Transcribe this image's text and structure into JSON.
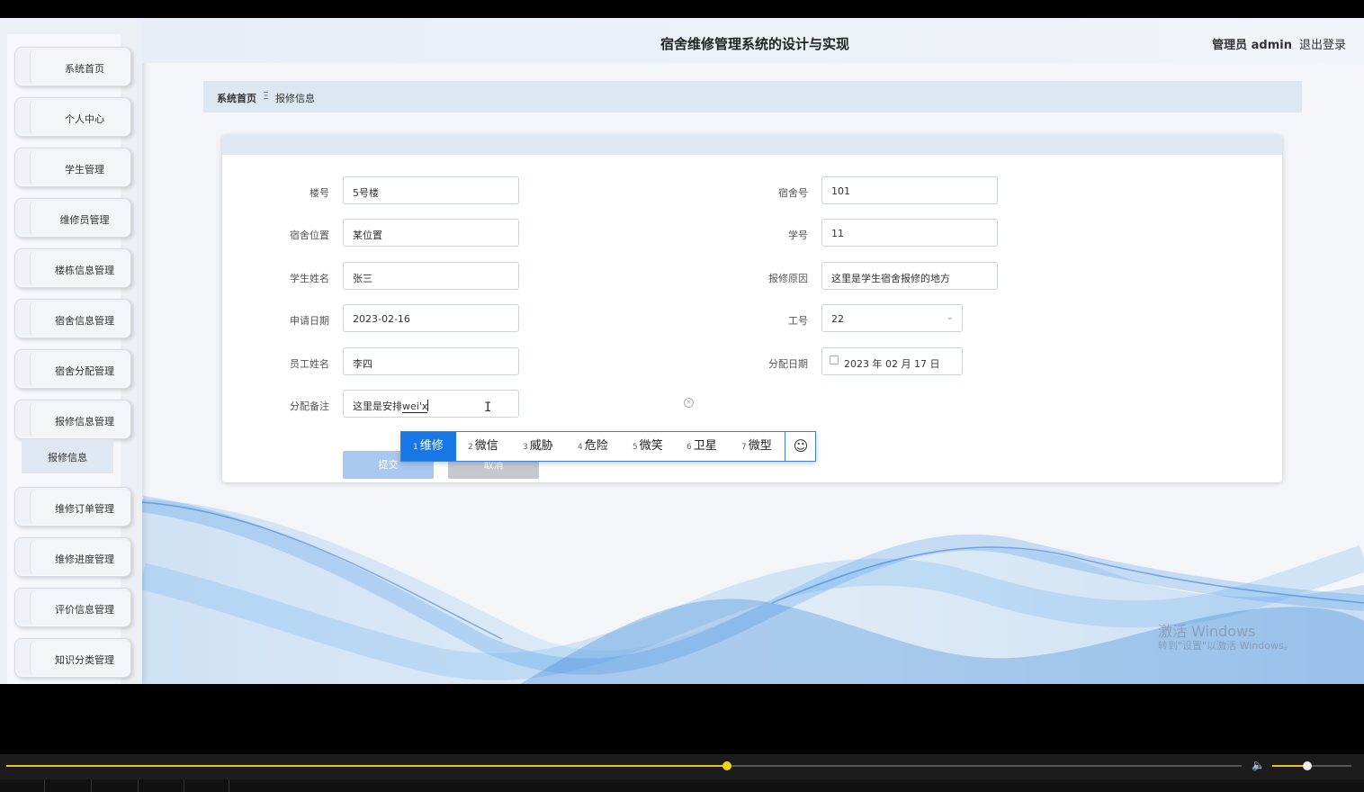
{
  "header": {
    "title": "宿舍维修管理系统的设计与实现",
    "user": "管理员 admin",
    "logout": "退出登录"
  },
  "sidebar": {
    "items": [
      {
        "label": "系统首页"
      },
      {
        "label": "个人中心"
      },
      {
        "label": "学生管理"
      },
      {
        "label": "维修员管理"
      },
      {
        "label": "楼栋信息管理"
      },
      {
        "label": "宿舍信息管理"
      },
      {
        "label": "宿舍分配管理"
      },
      {
        "label": "报修信息管理"
      },
      {
        "label": "维修订单管理"
      },
      {
        "label": "维修进度管理"
      },
      {
        "label": "评价信息管理"
      },
      {
        "label": "知识分类管理"
      }
    ],
    "active_sub": "报修信息"
  },
  "breadcrumb": {
    "home": "系统首页",
    "separator": "Ξ",
    "current": "报修信息"
  },
  "form": {
    "building": {
      "label": "楼号",
      "value": "5号楼"
    },
    "dorm_no": {
      "label": "宿舍号",
      "value": "101"
    },
    "dorm_location": {
      "label": "宿舍位置",
      "value": "某位置"
    },
    "student_no": {
      "label": "学号",
      "value": "11"
    },
    "student_name": {
      "label": "学生姓名",
      "value": "张三"
    },
    "repair_reason": {
      "label": "报修原因",
      "value": "这里是学生宿舍报修的地方"
    },
    "apply_date": {
      "label": "申请日期",
      "value": "2023-02-16"
    },
    "work_no": {
      "label": "工号",
      "value": "22"
    },
    "staff_name": {
      "label": "员工姓名",
      "value": "李四"
    },
    "assign_date": {
      "label": "分配日期",
      "value": "2023 年 02 月 17 日"
    },
    "assign_note": {
      "label": "分配备注",
      "value": "这里是安排",
      "composing": "wei'x"
    },
    "submit": "提交",
    "cancel": "取消"
  },
  "ime": {
    "candidates": [
      {
        "num": "1",
        "text": "维修"
      },
      {
        "num": "2",
        "text": "微信"
      },
      {
        "num": "3",
        "text": "威胁"
      },
      {
        "num": "4",
        "text": "危险"
      },
      {
        "num": "5",
        "text": "微笑"
      },
      {
        "num": "6",
        "text": "卫星"
      },
      {
        "num": "7",
        "text": "微型"
      }
    ],
    "emoji_icon": "☺"
  },
  "watermark": {
    "line1": "激活 Windows",
    "line2": "转到\"设置\"以激活 Windows。"
  },
  "player": {
    "progress": 0.58,
    "volume": 0.44
  },
  "colors": {
    "accent": "#1677e5",
    "progress": "#e6c41a"
  }
}
